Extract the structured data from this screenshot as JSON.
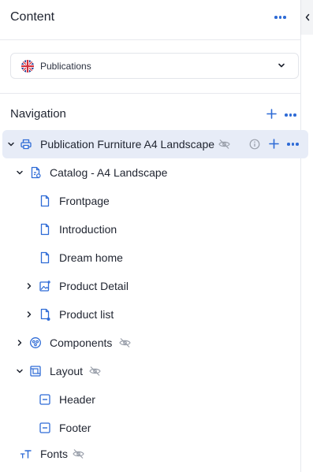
{
  "panel": {
    "title": "Content"
  },
  "site_selector": {
    "value": "Publications",
    "flag": "uk-flag-icon"
  },
  "navigation": {
    "title": "Navigation"
  },
  "tree": [
    {
      "label": "Publication Furniture A4 Landscape",
      "icon": "print-icon",
      "selected": true,
      "hidden": true
    },
    {
      "label": "Catalog - A4 Landscape",
      "icon": "document-settings-icon"
    },
    {
      "label": "Frontpage",
      "icon": "file-icon"
    },
    {
      "label": "Introduction",
      "icon": "file-icon"
    },
    {
      "label": "Dream home",
      "icon": "file-icon"
    },
    {
      "label": "Product Detail",
      "icon": "image-plus-icon"
    },
    {
      "label": "Product list",
      "icon": "file-dot-icon"
    },
    {
      "label": "Components",
      "icon": "components-icon",
      "hidden": true
    },
    {
      "label": "Layout",
      "icon": "layout-icon",
      "hidden": true
    },
    {
      "label": "Header",
      "icon": "minus-box-icon"
    },
    {
      "label": "Footer",
      "icon": "minus-box-icon"
    },
    {
      "label": "Fonts",
      "icon": "text-size-icon",
      "hidden": true
    }
  ],
  "colors": {
    "accent": "#2e6bd6",
    "selected_row": "#e7ecf7",
    "muted_icon": "#9aa0ab"
  }
}
